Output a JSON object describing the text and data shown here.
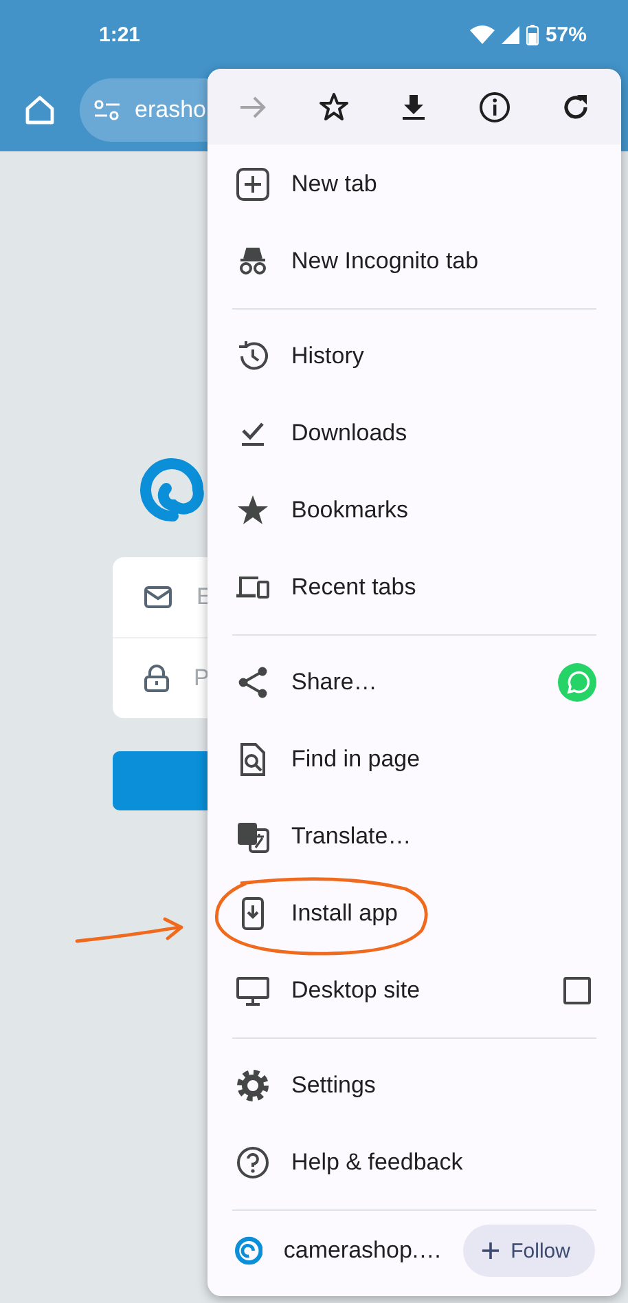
{
  "status_bar": {
    "time": "1:21",
    "battery": "57%"
  },
  "toolbar": {
    "address": "erasho"
  },
  "page": {
    "fields": [
      {
        "placeholder": "E"
      },
      {
        "placeholder": "P"
      }
    ]
  },
  "menu": {
    "top_actions": [
      {
        "disabled": true
      },
      {
        "disabled": false
      },
      {
        "disabled": false
      },
      {
        "disabled": false
      },
      {
        "disabled": false
      }
    ],
    "sections": [
      [
        {
          "label": "New tab",
          "kind": "plain"
        },
        {
          "label": "New Incognito tab",
          "kind": "plain"
        }
      ],
      [
        {
          "label": "History",
          "kind": "plain"
        },
        {
          "label": "Downloads",
          "kind": "plain"
        },
        {
          "label": "Bookmarks",
          "kind": "plain"
        },
        {
          "label": "Recent tabs",
          "kind": "plain"
        }
      ],
      [
        {
          "label": "Share…",
          "kind": "app-badge"
        },
        {
          "label": "Find in page",
          "kind": "plain"
        },
        {
          "label": "Translate…",
          "kind": "plain"
        },
        {
          "label": "Install app",
          "kind": "plain"
        },
        {
          "label": "Desktop site",
          "kind": "checkbox",
          "checked": false
        }
      ],
      [
        {
          "label": "Settings",
          "kind": "plain"
        },
        {
          "label": "Help & feedback",
          "kind": "plain"
        }
      ]
    ],
    "footer": {
      "site": "camerashop.…",
      "button": "Follow"
    }
  }
}
